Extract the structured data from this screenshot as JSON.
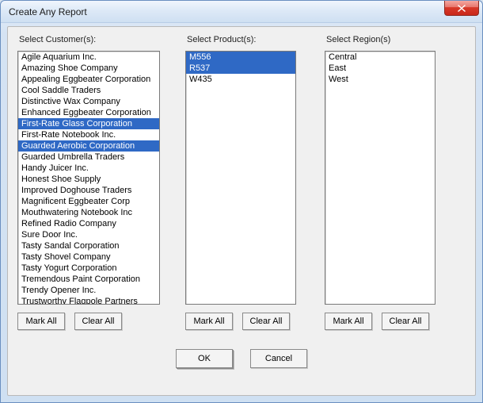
{
  "window": {
    "title": "Create Any Report"
  },
  "labels": {
    "customers": "Select Customer(s):",
    "products": "Select Product(s):",
    "regions": "Select Region(s)"
  },
  "buttons": {
    "mark_all": "Mark All",
    "clear_all": "Clear All",
    "ok": "OK",
    "cancel": "Cancel"
  },
  "customers": {
    "items": [
      {
        "label": "Agile Aquarium Inc.",
        "selected": false
      },
      {
        "label": "Amazing Shoe Company",
        "selected": false
      },
      {
        "label": "Appealing Eggbeater Corporation",
        "selected": false
      },
      {
        "label": "Cool Saddle Traders",
        "selected": false
      },
      {
        "label": "Distinctive Wax Company",
        "selected": false
      },
      {
        "label": "Enhanced Eggbeater Corporation",
        "selected": false
      },
      {
        "label": "First-Rate Glass Corporation",
        "selected": true
      },
      {
        "label": "First-Rate Notebook Inc.",
        "selected": false
      },
      {
        "label": "Guarded Aerobic Corporation",
        "selected": true
      },
      {
        "label": "Guarded Umbrella Traders",
        "selected": false
      },
      {
        "label": "Handy Juicer Inc.",
        "selected": false
      },
      {
        "label": "Honest Shoe Supply",
        "selected": false
      },
      {
        "label": "Improved Doghouse Traders",
        "selected": false
      },
      {
        "label": "Magnificent Eggbeater Corp",
        "selected": false
      },
      {
        "label": "Mouthwatering Notebook Inc",
        "selected": false
      },
      {
        "label": "Refined Radio Company",
        "selected": false
      },
      {
        "label": "Sure Door Inc.",
        "selected": false
      },
      {
        "label": "Tasty Sandal Corporation",
        "selected": false
      },
      {
        "label": "Tasty Shovel Company",
        "selected": false
      },
      {
        "label": "Tasty Yogurt Corporation",
        "selected": false
      },
      {
        "label": "Tremendous Paint Corporation",
        "selected": false
      },
      {
        "label": "Trendy Opener Inc.",
        "selected": false
      },
      {
        "label": "Trustworthy Flagpole Partners",
        "selected": false
      }
    ]
  },
  "products": {
    "items": [
      {
        "label": "M556",
        "selected": true
      },
      {
        "label": "R537",
        "selected": true
      },
      {
        "label": "W435",
        "selected": false
      }
    ]
  },
  "regions": {
    "items": [
      {
        "label": "Central",
        "selected": false
      },
      {
        "label": "East",
        "selected": false
      },
      {
        "label": "West",
        "selected": false
      }
    ]
  }
}
